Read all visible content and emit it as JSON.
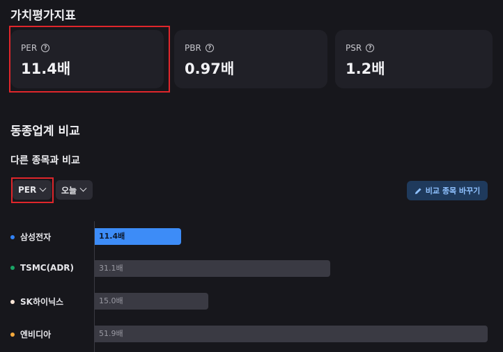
{
  "valuation": {
    "title": "가치평가지표",
    "cards": [
      {
        "label": "PER",
        "value": "11.4배"
      },
      {
        "label": "PBR",
        "value": "0.97배"
      },
      {
        "label": "PSR",
        "value": "1.2배"
      }
    ]
  },
  "peers": {
    "title": "동종업계 비교",
    "subtitle": "다른 종목과 비교",
    "metric_select": "PER",
    "period_select": "오늘",
    "change_button": "비교 종목 바꾸기",
    "rows": [
      {
        "name": "삼성전자",
        "value": 11.4,
        "label": "11.4배",
        "color": "#3182f6",
        "highlight": true
      },
      {
        "name": "TSMC(ADR)",
        "value": 31.1,
        "label": "31.1배",
        "color": "#1aa566",
        "highlight": false
      },
      {
        "name": "SK하이닉스",
        "value": 15.0,
        "label": "15.0배",
        "color": "#fbe5d6",
        "highlight": false
      },
      {
        "name": "엔비디아",
        "value": 51.9,
        "label": "51.9배",
        "color": "#f5a93b",
        "highlight": false
      }
    ]
  }
}
